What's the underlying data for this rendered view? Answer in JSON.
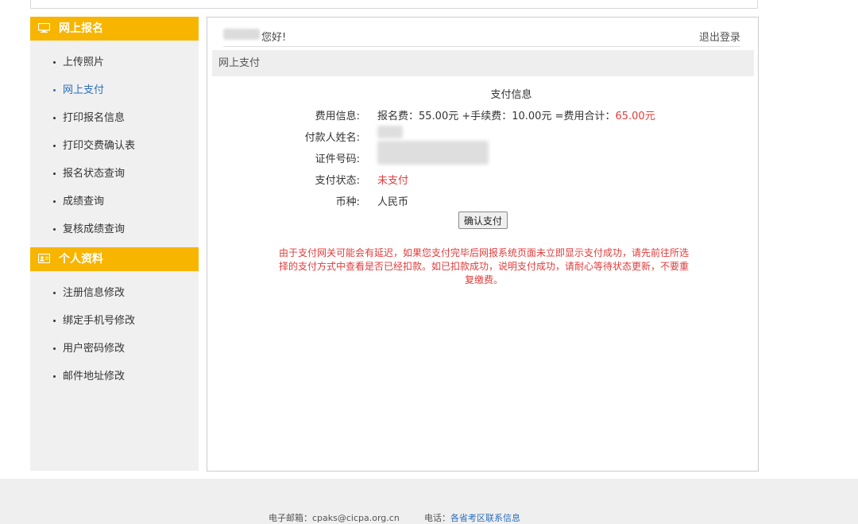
{
  "sidebar": {
    "sections": [
      {
        "title": "网上报名",
        "icon": "monitor-icon",
        "items": [
          {
            "label": "上传照片",
            "active": false
          },
          {
            "label": "网上支付",
            "active": true
          },
          {
            "label": "打印报名信息",
            "active": false
          },
          {
            "label": "打印交费确认表",
            "active": false
          },
          {
            "label": "报名状态查询",
            "active": false
          },
          {
            "label": "成绩查询",
            "active": false
          },
          {
            "label": "复核成绩查询",
            "active": false
          }
        ]
      },
      {
        "title": "个人资料",
        "icon": "id-card-icon",
        "items": [
          {
            "label": "注册信息修改",
            "active": false
          },
          {
            "label": "绑定手机号修改",
            "active": false
          },
          {
            "label": "用户密码修改",
            "active": false
          },
          {
            "label": "邮件地址修改",
            "active": false
          }
        ]
      }
    ]
  },
  "header": {
    "greeting": "您好!",
    "logout": "退出登录"
  },
  "page": {
    "subtitle": "网上支付",
    "info_title": "支付信息",
    "fee_label": "费用信息:",
    "fee_detail": "报名费：55.00元 +手续费：10.00元 =费用合计：",
    "fee_total": "65.00元",
    "payer_label": "付款人姓名:",
    "id_label": "证件号码:",
    "status_label": "支付状态:",
    "status_value": "未支付",
    "currency_label": "币种:",
    "currency_value": "人民币",
    "confirm_button": "确认支付",
    "notice": "由于支付网关可能会有延迟，如果您支付完毕后网报系统页面未立即显示支付成功，请先前往所选择的支付方式中查看是否已经扣款。如已扣款成功，说明支付成功，请耐心等待状态更新，不要重复缴费。"
  },
  "footer": {
    "email_label": "电子邮箱：",
    "email_value": "cpaks@cicpa.org.cn",
    "phone_label": "电话：",
    "phone_link": "各省考区联系信息"
  },
  "colors": {
    "accent": "#f7b500",
    "link": "#2a6fbf",
    "alert": "#e03c3c"
  }
}
